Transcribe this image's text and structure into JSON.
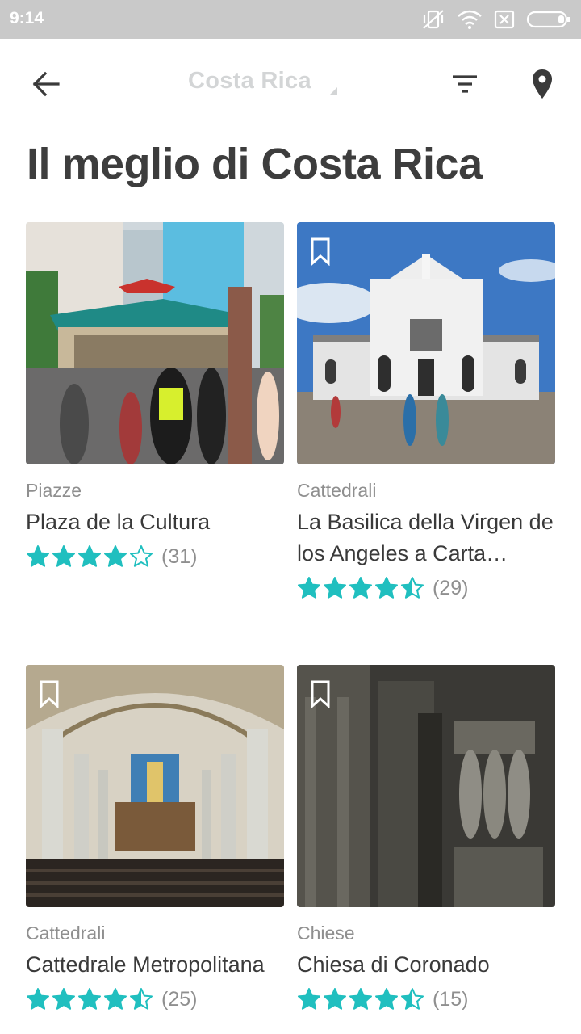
{
  "status_bar": {
    "time": "9:14",
    "icons": [
      "vibrate-icon",
      "wifi-icon",
      "no-sim-icon",
      "battery-icon"
    ]
  },
  "app_bar": {
    "title": "Costa Rica",
    "back_icon": "arrow-left-icon",
    "filter_icon": "filter-icon",
    "map_icon": "map-pin-icon"
  },
  "page": {
    "heading": "Il meglio di Costa Rica"
  },
  "colors": {
    "star": "#20bfbf",
    "status_bar": "#c9c9c9",
    "title_inactive": "#d3d5d6"
  },
  "cards": [
    {
      "category": "Piazze",
      "title": "Plaza de la Cultura",
      "rating": 4,
      "count": "(31)",
      "bookmark": false
    },
    {
      "category": "Cattedrali",
      "title": "La Basilica della Virgen de los Angeles a Carta…",
      "rating": 4.5,
      "count": "(29)",
      "bookmark": true
    },
    {
      "category": "Cattedrali",
      "title": "Cattedrale Metropolitana",
      "rating": 4.5,
      "count": "(25)",
      "bookmark": true
    },
    {
      "category": "Chiese",
      "title": "Chiesa di Coronado",
      "rating": 4.5,
      "count": "(15)",
      "bookmark": true
    }
  ]
}
